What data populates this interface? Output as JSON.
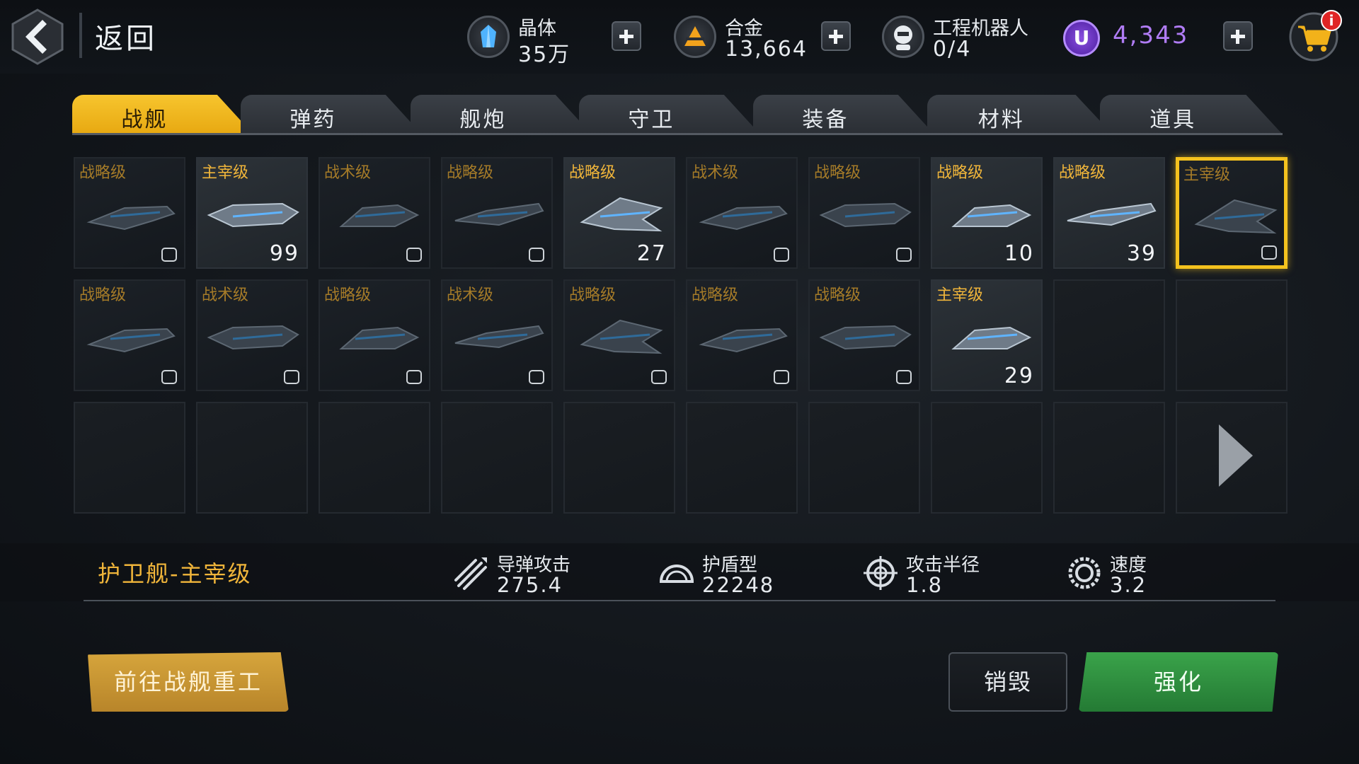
{
  "topbar": {
    "back_label": "返回",
    "crystal": {
      "label": "晶体",
      "value": "35万",
      "icon": "crystal-icon",
      "color": "#4fb3ff"
    },
    "alloy": {
      "label": "合金",
      "value": "13,664",
      "icon": "alloy-icon",
      "color": "#f2a21c"
    },
    "robot": {
      "label": "工程机器人",
      "value": "0/4",
      "icon": "robot-icon"
    },
    "u_currency": {
      "symbol": "U",
      "value": "4,343",
      "color": "#b07cf5"
    },
    "cart_badge": "i"
  },
  "tabs": [
    {
      "label": "战舰",
      "active": true
    },
    {
      "label": "弹药",
      "active": false
    },
    {
      "label": "舰炮",
      "active": false
    },
    {
      "label": "守卫",
      "active": false
    },
    {
      "label": "装备",
      "active": false
    },
    {
      "label": "材料",
      "active": false
    },
    {
      "label": "道具",
      "active": false
    }
  ],
  "inventory": [
    {
      "grade": "战略级",
      "count": "",
      "lit": false,
      "selected": false
    },
    {
      "grade": "主宰级",
      "count": "99",
      "lit": true,
      "selected": false
    },
    {
      "grade": "战术级",
      "count": "",
      "lit": false,
      "selected": false
    },
    {
      "grade": "战略级",
      "count": "",
      "lit": false,
      "selected": false
    },
    {
      "grade": "战略级",
      "count": "27",
      "lit": true,
      "selected": false
    },
    {
      "grade": "战术级",
      "count": "",
      "lit": false,
      "selected": false
    },
    {
      "grade": "战略级",
      "count": "",
      "lit": false,
      "selected": false
    },
    {
      "grade": "战略级",
      "count": "10",
      "lit": true,
      "selected": false
    },
    {
      "grade": "战略级",
      "count": "39",
      "lit": true,
      "selected": false
    },
    {
      "grade": "主宰级",
      "count": "",
      "lit": false,
      "selected": true
    },
    {
      "grade": "战略级",
      "count": "",
      "lit": false,
      "selected": false
    },
    {
      "grade": "战术级",
      "count": "",
      "lit": false,
      "selected": false
    },
    {
      "grade": "战略级",
      "count": "",
      "lit": false,
      "selected": false
    },
    {
      "grade": "战术级",
      "count": "",
      "lit": false,
      "selected": false
    },
    {
      "grade": "战略级",
      "count": "",
      "lit": false,
      "selected": false
    },
    {
      "grade": "战略级",
      "count": "",
      "lit": false,
      "selected": false
    },
    {
      "grade": "战略级",
      "count": "",
      "lit": false,
      "selected": false
    },
    {
      "grade": "主宰级",
      "count": "29",
      "lit": true,
      "selected": false
    }
  ],
  "detail": {
    "ship_name": "护卫舰-主宰级",
    "missile": {
      "label": "导弹攻击",
      "value": "275.4"
    },
    "shield": {
      "label": "护盾型",
      "value": "22248"
    },
    "range": {
      "label": "攻击半径",
      "value": "1.8"
    },
    "speed": {
      "label": "速度",
      "value": "3.2"
    }
  },
  "buttons": {
    "goto": "前往战舰重工",
    "destroy": "销毁",
    "enhance": "强化"
  }
}
